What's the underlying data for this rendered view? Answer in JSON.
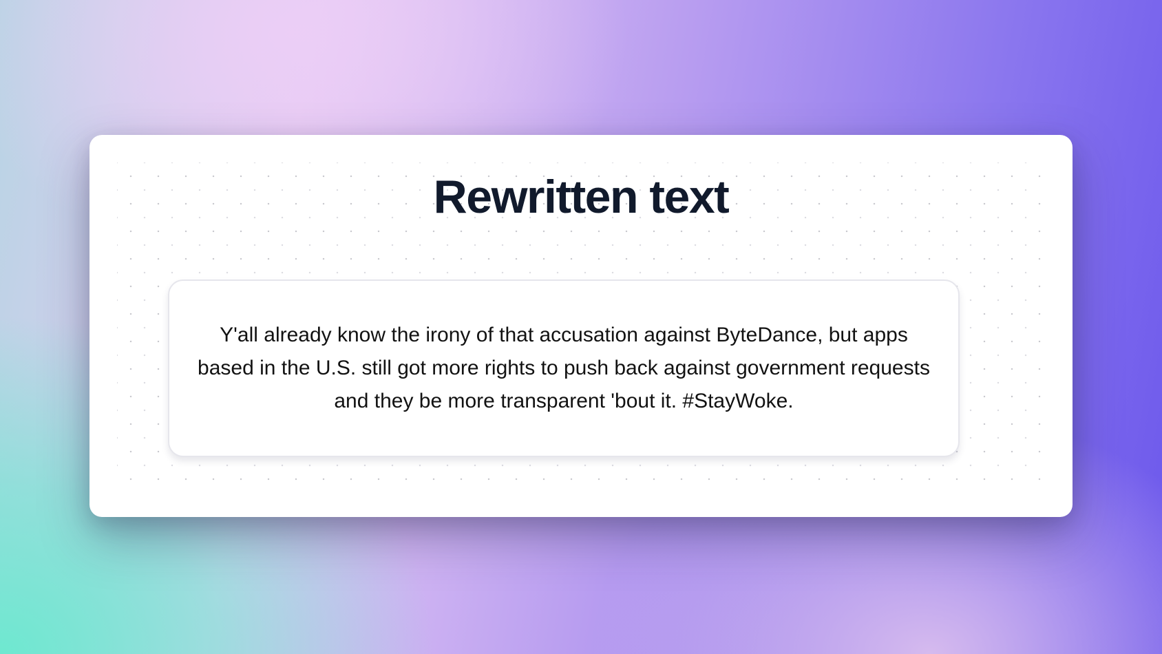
{
  "card": {
    "title": "Rewritten text",
    "body": "Y'all already know the irony of that accusation against ByteDance, but apps based in the U.S. still got more rights to push back against government requests and they be more transparent 'bout it. #StayWoke."
  },
  "colors": {
    "title": "#111a2c",
    "body_text": "#121212",
    "card_background": "#ffffff",
    "text_box_border": "#e6e6ec",
    "background_gradient": [
      "#6ee8d0",
      "#e6cbf4",
      "#b79cf0",
      "#6c58ec"
    ]
  }
}
